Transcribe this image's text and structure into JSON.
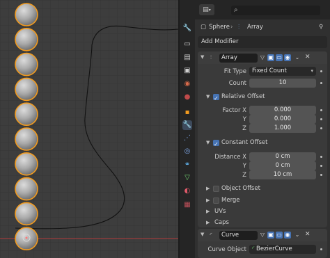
{
  "colors": {
    "accent": "#4673b3",
    "sphere_outline": "#f29b1f",
    "curve": "#111111",
    "axis_x": "#b33a3a"
  },
  "viewport": {
    "sphere_count": 10,
    "origin_icon": "origin-icon"
  },
  "header": {
    "editor_type_icon": "properties-icon",
    "dropdown_icon": "chevron-down-icon",
    "search_icon": "search-icon"
  },
  "breadcrumb": {
    "object": "Sphere",
    "separator": "›",
    "modifier": "Array",
    "pin_icon": "pin-icon"
  },
  "add_modifier": {
    "label": "Add Modifier"
  },
  "array": {
    "name": "Array",
    "fit_type_label": "Fit Type",
    "fit_type_value": "Fixed Count",
    "count_label": "Count",
    "count_value": "10",
    "relative_offset_label": "Relative Offset",
    "factor_x_label": "Factor X",
    "factor_x": "0.000",
    "y_label": "Y",
    "factor_y": "0.000",
    "z_label": "Z",
    "factor_z": "1.000",
    "constant_offset_label": "Constant Offset",
    "distance_x_label": "Distance X",
    "distance_x": "0 cm",
    "distance_y": "0 cm",
    "distance_z": "10 cm",
    "object_offset_label": "Object Offset",
    "merge_label": "Merge",
    "uvs_label": "UVs",
    "caps_label": "Caps"
  },
  "curve_modifier": {
    "name": "Curve",
    "curve_object_label": "Curve Object",
    "curve_object_value": "BezierCurve"
  }
}
